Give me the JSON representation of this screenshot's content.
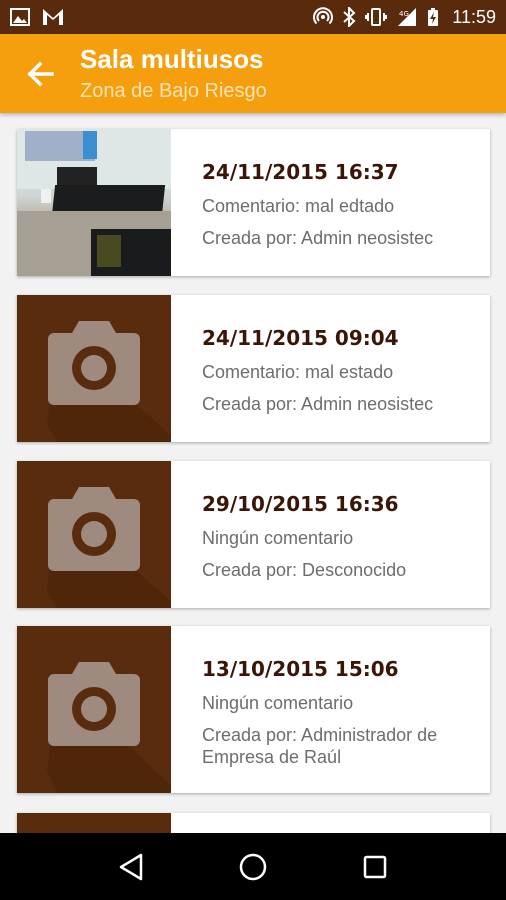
{
  "status_bar": {
    "time": "11:59",
    "icons": [
      "image-icon",
      "gmail-icon",
      "hotspot-icon",
      "bluetooth-icon",
      "vibrate-icon",
      "signal-4g-icon",
      "battery-charging-icon"
    ]
  },
  "app_bar": {
    "title": "Sala multiusos",
    "subtitle": "Zona de Bajo Riesgo",
    "back_icon": "arrow-back-icon"
  },
  "colors": {
    "status_bar": "#5a2a0c",
    "app_bar": "#f59f0f",
    "placeholder_bg": "#5a2c0e",
    "date_text": "#3a1608",
    "secondary_text": "#6d6d6d"
  },
  "items": [
    {
      "date": "24/11/2015 16:37",
      "comment": "Comentario: mal edtado",
      "author": "Creada por: Admin neosistec",
      "thumbnail": "photo"
    },
    {
      "date": "24/11/2015 09:04",
      "comment": "Comentario: mal estado",
      "author": "Creada por: Admin neosistec",
      "thumbnail": "camera-placeholder"
    },
    {
      "date": "29/10/2015 16:36",
      "comment": "Ningún comentario",
      "author": "Creada por: Desconocido",
      "thumbnail": "camera-placeholder"
    },
    {
      "date": "13/10/2015 15:06",
      "comment": "Ningún comentario",
      "author": "Creada por: Administrador de Empresa de Raúl",
      "thumbnail": "camera-placeholder"
    }
  ],
  "nav_bar": {
    "icons": [
      "back-triangle-icon",
      "home-circle-icon",
      "recents-square-icon"
    ]
  }
}
